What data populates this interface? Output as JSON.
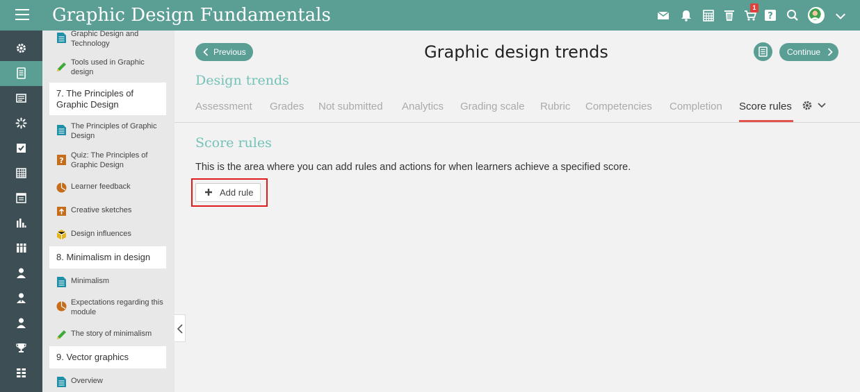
{
  "app": {
    "title": "Graphic Design Fundamentals",
    "accent": "#5a9e94",
    "cart_count": "1"
  },
  "topbar_icons": [
    "envelope-icon",
    "bell-icon",
    "calendar-icon",
    "trash-icon",
    "cart-icon",
    "help-icon",
    "search-icon",
    "avatar",
    "chevron-down-icon"
  ],
  "leftnav": [
    "gear-icon",
    "course-book-icon",
    "news-icon",
    "spinner-icon",
    "checklist-icon",
    "grid-calendar-icon",
    "calendar-icon",
    "bar-chart-icon",
    "library-icon",
    "user-icon",
    "user-tie-icon",
    "user-alt-icon",
    "trophy-icon",
    "apps-icon"
  ],
  "sidebar": {
    "items": [
      {
        "label": "Graphic Design and Technology",
        "icon": "document-icon"
      },
      {
        "label": "Tools used in Graphic design",
        "icon": "pencil-icon"
      },
      {
        "label": "7. The Principles of Graphic Design",
        "section": true
      },
      {
        "label": "The Principles of Graphic Design",
        "icon": "document-icon"
      },
      {
        "label": "Quiz: The Principles of Graphic Design",
        "icon": "quiz-icon"
      },
      {
        "label": "Learner feedback",
        "icon": "survey-icon"
      },
      {
        "label": "Creative sketches",
        "icon": "upload-icon"
      },
      {
        "label": "Design influences",
        "icon": "package-icon"
      },
      {
        "label": "8. Minimalism in design",
        "section": true
      },
      {
        "label": "Minimalism",
        "icon": "document-icon"
      },
      {
        "label": "Expectations regarding this module",
        "icon": "survey-icon"
      },
      {
        "label": "The story of minimalism",
        "icon": "pencil-icon"
      },
      {
        "label": "9. Vector graphics",
        "section": true
      },
      {
        "label": "Overview",
        "icon": "document-icon"
      }
    ]
  },
  "main": {
    "previous_label": "Previous",
    "continue_label": "Continue",
    "page_title": "Graphic design trends",
    "section_title": "Design trends",
    "tabs": [
      {
        "label": "Assessment"
      },
      {
        "label": "Grades"
      },
      {
        "label": "Not submitted"
      },
      {
        "label": "Analytics"
      },
      {
        "label": "Grading scale"
      },
      {
        "label": "Rubric"
      },
      {
        "label": "Competencies"
      },
      {
        "label": "Completion"
      },
      {
        "label": "Score rules",
        "active": true
      }
    ],
    "sub_title": "Score rules",
    "description": "This is the area where you can add rules and actions for when learners achieve a specified score.",
    "add_rule_label": "Add rule"
  }
}
